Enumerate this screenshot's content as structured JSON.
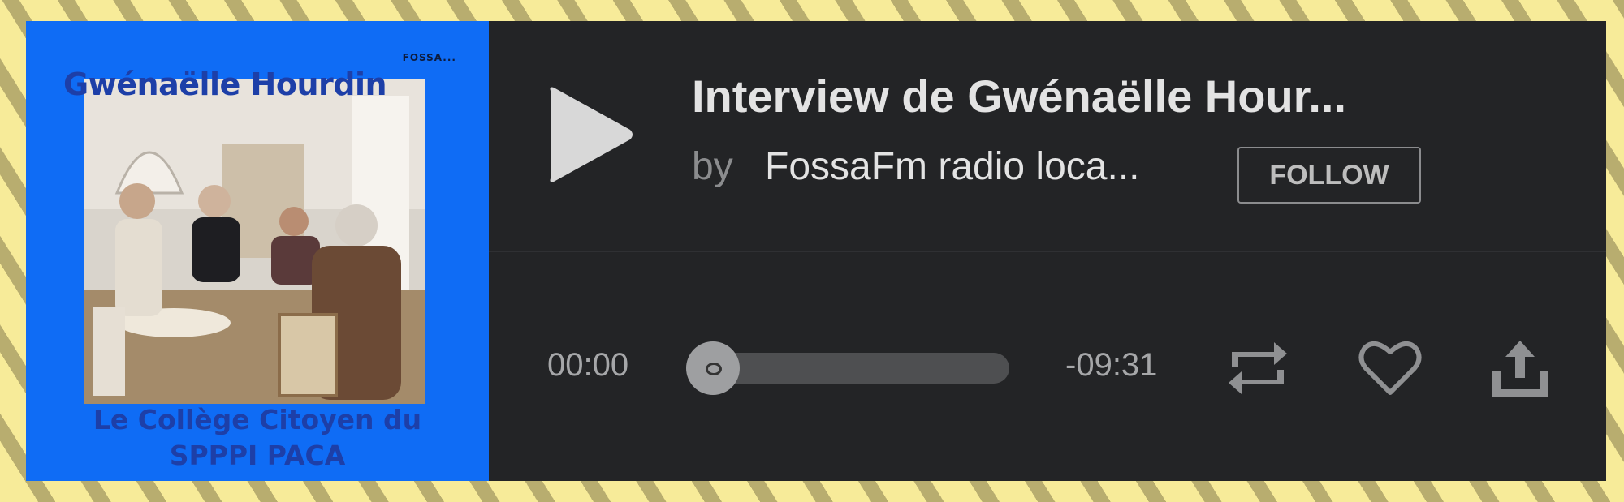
{
  "cover": {
    "title": "Gwénaëlle Hourdin",
    "corner_text": "FOSSA...",
    "subtitle_line1": "Le Collège Citoyen du",
    "subtitle_line2": "SPPPI PACA"
  },
  "track": {
    "title": "Interview de Gwénaëlle Hour...",
    "by_label": "by",
    "artist": "FossaFm radio loca...",
    "follow_label": "FOLLOW"
  },
  "playback": {
    "elapsed": "00:00",
    "remaining": "-09:31",
    "progress": 0
  },
  "icons": {
    "play": "play-icon",
    "repost": "repost-icon",
    "like": "heart-icon",
    "share": "share-icon"
  },
  "colors": {
    "page_bg": "#f7eb99",
    "player_bg": "#232426",
    "cover_bg": "#0f6cf5",
    "text_primary": "#e3e3e3",
    "text_secondary": "#8b8c8e"
  }
}
